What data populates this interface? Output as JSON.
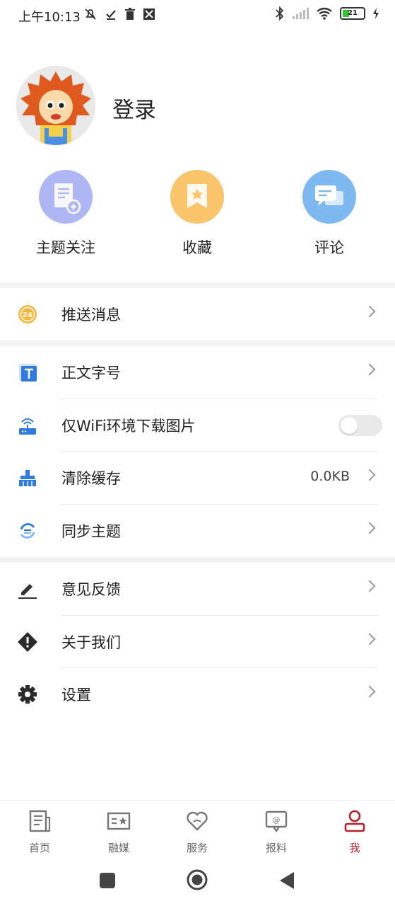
{
  "status_bar": {
    "time": "上午10:13",
    "battery": "21"
  },
  "profile": {
    "login_label": "登录"
  },
  "quick_actions": [
    {
      "label": "主题关注",
      "icon": "document-add-icon",
      "color": "#aeb6f3"
    },
    {
      "label": "收藏",
      "icon": "bookmark-icon",
      "color": "#f9c46a"
    },
    {
      "label": "评论",
      "icon": "chat-icon",
      "color": "#7db8f1"
    }
  ],
  "menu": {
    "push": {
      "label": "推送消息",
      "icon": "24h-icon"
    },
    "font_size": {
      "label": "正文字号",
      "icon": "text-size-icon"
    },
    "wifi_images": {
      "label": "仅WiFi环境下载图片",
      "icon": "router-icon",
      "enabled": false
    },
    "clear_cache": {
      "label": "清除缓存",
      "value": "0.0KB",
      "icon": "brush-icon"
    },
    "sync_theme": {
      "label": "同步主题",
      "icon": "sync-icon"
    },
    "feedback": {
      "label": "意见反馈",
      "icon": "pencil-icon"
    },
    "about": {
      "label": "关于我们",
      "icon": "info-diamond-icon"
    },
    "settings": {
      "label": "设置",
      "icon": "gear-icon"
    }
  },
  "tabs": [
    {
      "label": "首页",
      "icon": "news-icon",
      "active": false
    },
    {
      "label": "融媒",
      "icon": "media-card-icon",
      "active": false
    },
    {
      "label": "服务",
      "icon": "heart-hands-icon",
      "active": false
    },
    {
      "label": "报料",
      "icon": "report-bubble-icon",
      "active": false
    },
    {
      "label": "我",
      "icon": "person-icon",
      "active": true
    }
  ],
  "colors": {
    "accent": "#b4232b",
    "blue_icon": "#2f7be0"
  }
}
